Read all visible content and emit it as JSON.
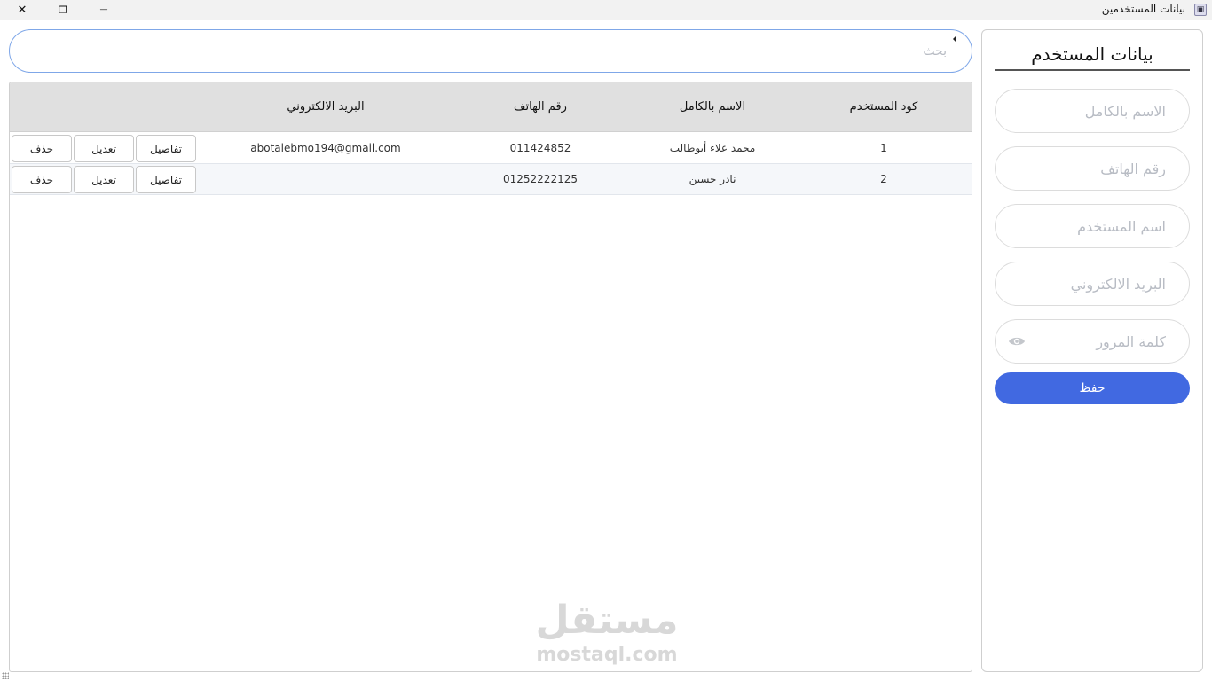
{
  "window": {
    "title": "بيانات المستخدمين",
    "close_glyph": "✕",
    "maximize_glyph": "❐",
    "minimize_glyph": "—",
    "icon": "app-icon"
  },
  "form": {
    "title": "بيانات المستخدم",
    "full_name_placeholder": "الاسم بالكامل",
    "phone_placeholder": "رقم الهاتف",
    "username_placeholder": "اسم المستخدم",
    "email_placeholder": "البريد الالكتروني",
    "password_placeholder": "كلمة المرور",
    "password_toggle_icon": "eye-icon",
    "save_label": "حفظ"
  },
  "search": {
    "placeholder": "بحث"
  },
  "table": {
    "headers": {
      "code": "كود المستخدم",
      "full_name": "الاسم بالكامل",
      "phone": "رقم الهاتف",
      "email": "البريد الالكتروني"
    },
    "actions": {
      "details": "تفاصيل",
      "edit": "تعديل",
      "delete": "حذف"
    },
    "rows": [
      {
        "code": "1",
        "full_name": "محمد علاء أبوطالب",
        "phone": "011424852",
        "email": "abotalebmo194@gmail.com"
      },
      {
        "code": "2",
        "full_name": "نادر حسين",
        "phone": "01252222125",
        "email": ""
      }
    ]
  },
  "watermark": {
    "arabic": "مستقل",
    "latin": "mostaql.com"
  },
  "colors": {
    "accent": "#4169e1",
    "search_border": "#7fa7e8",
    "header_bg": "#e0e0e0"
  }
}
